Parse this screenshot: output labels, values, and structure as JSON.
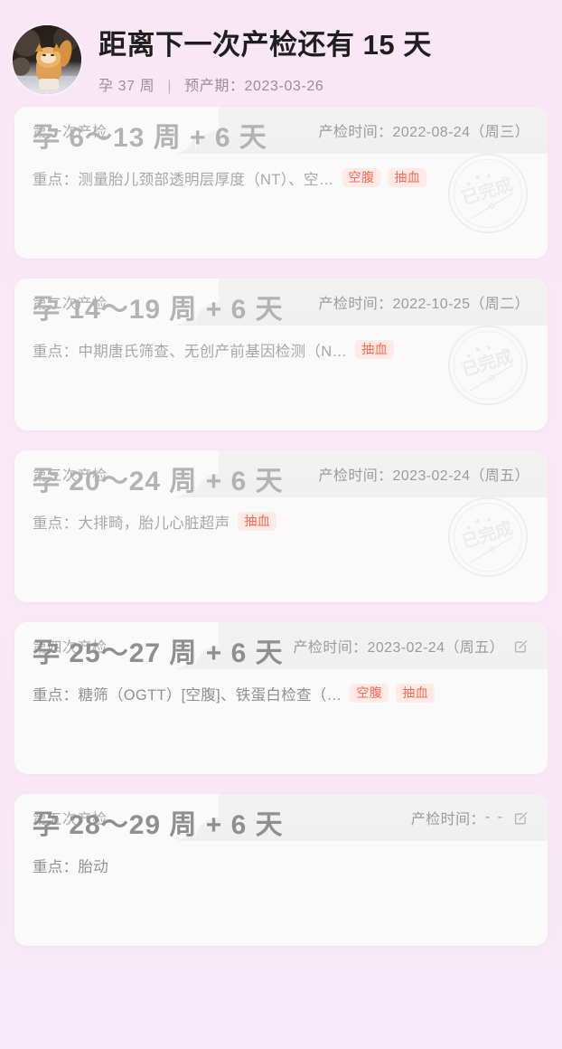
{
  "header": {
    "avatar_alt": "cat-avatar",
    "title": "距离下一次产检还有 15 天",
    "gest_week": "孕 37 周",
    "separator": "|",
    "due": "预产期：2023-03-26"
  },
  "labels": {
    "schedule_prefix": "产检时间：",
    "focus_prefix": "重点：",
    "stamp_text": "已完成",
    "edit_icon": "edit-square-icon"
  },
  "cards": [
    {
      "seq": "第一次产检",
      "date": "2022-08-24（周三）",
      "weeks": "孕 6～13 周 + 6 天",
      "focus": "重点：测量胎儿颈部透明层厚度（NT）、空…",
      "tags": [
        "空腹",
        "抽血"
      ],
      "completed": true,
      "editable": false
    },
    {
      "seq": "第二次产检",
      "date": "2022-10-25（周二）",
      "weeks": "孕 14～19 周 + 6 天",
      "focus": "重点：中期唐氏筛查、无创产前基因检测（N…",
      "tags": [
        "抽血"
      ],
      "completed": true,
      "editable": false
    },
    {
      "seq": "第三次产检",
      "date": "2023-02-24（周五）",
      "weeks": "孕 20～24 周 + 6 天",
      "focus": "重点：大排畸，胎儿心脏超声",
      "tags": [
        "抽血"
      ],
      "completed": true,
      "editable": false
    },
    {
      "seq": "第四次产检",
      "date": "2023-02-24（周五）",
      "weeks": "孕 25～27 周 + 6 天",
      "focus": "重点：糖筛（OGTT）[空腹]、铁蛋白检查（…",
      "tags": [
        "空腹",
        "抽血"
      ],
      "completed": false,
      "editable": true
    },
    {
      "seq": "第五次产检",
      "date": "- -",
      "weeks": "孕 28～29 周 + 6 天",
      "focus": "重点：胎动",
      "tags": [],
      "completed": false,
      "editable": true
    }
  ],
  "colors": {
    "page_bg": "#f9e8f6",
    "card_bg": "#fafafa",
    "card_strip": "#f1f1f1",
    "title": "#201f20",
    "muted": "#a8a8a8",
    "tag_bg": "#ffeae6",
    "tag_fg": "#fa6a55"
  }
}
